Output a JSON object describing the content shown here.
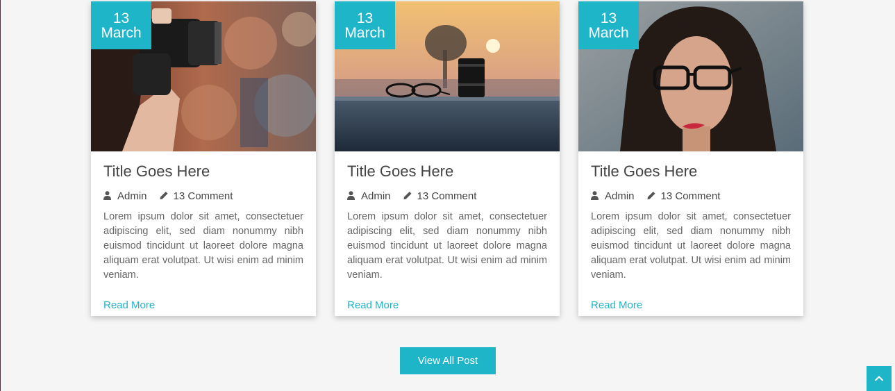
{
  "posts": [
    {
      "date_day": "13",
      "date_month": "March",
      "image": "photographer-with-camera",
      "title": "Title Goes Here",
      "author": "Admin",
      "comments": "13 Comment",
      "excerpt": "Lorem ipsum dolor sit amet, consectetuer adipiscing elit, sed diam nonummy nibh euismod tincidunt ut laoreet dolore magna aliquam erat volutpat. Ut wisi enim ad minim veniam.",
      "read_more": "Read More"
    },
    {
      "date_day": "13",
      "date_month": "March",
      "image": "glasses-and-lens-at-sunset",
      "title": "Title Goes Here",
      "author": "Admin",
      "comments": "13 Comment",
      "excerpt": "Lorem ipsum dolor sit amet, consectetuer adipiscing elit, sed diam nonummy nibh euismod tincidunt ut laoreet dolore magna aliquam erat volutpat. Ut wisi enim ad minim veniam.",
      "read_more": "Read More"
    },
    {
      "date_day": "13",
      "date_month": "March",
      "image": "woman-with-glasses-portrait",
      "title": "Title Goes Here",
      "author": "Admin",
      "comments": "13 Comment",
      "excerpt": "Lorem ipsum dolor sit amet, consectetuer adipiscing elit, sed diam nonummy nibh euismod tincidunt ut laoreet dolore magna aliquam erat volutpat. Ut wisi enim ad minim veniam.",
      "read_more": "Read More"
    }
  ],
  "view_all_label": "View All Post",
  "icons": {
    "author": "user-icon",
    "comments": "pencil-icon",
    "scroll_top": "chevron-up-icon"
  },
  "colors": {
    "accent": "#1fb5c9",
    "background": "#f5f5f5",
    "title": "#444444",
    "text": "#666666"
  }
}
